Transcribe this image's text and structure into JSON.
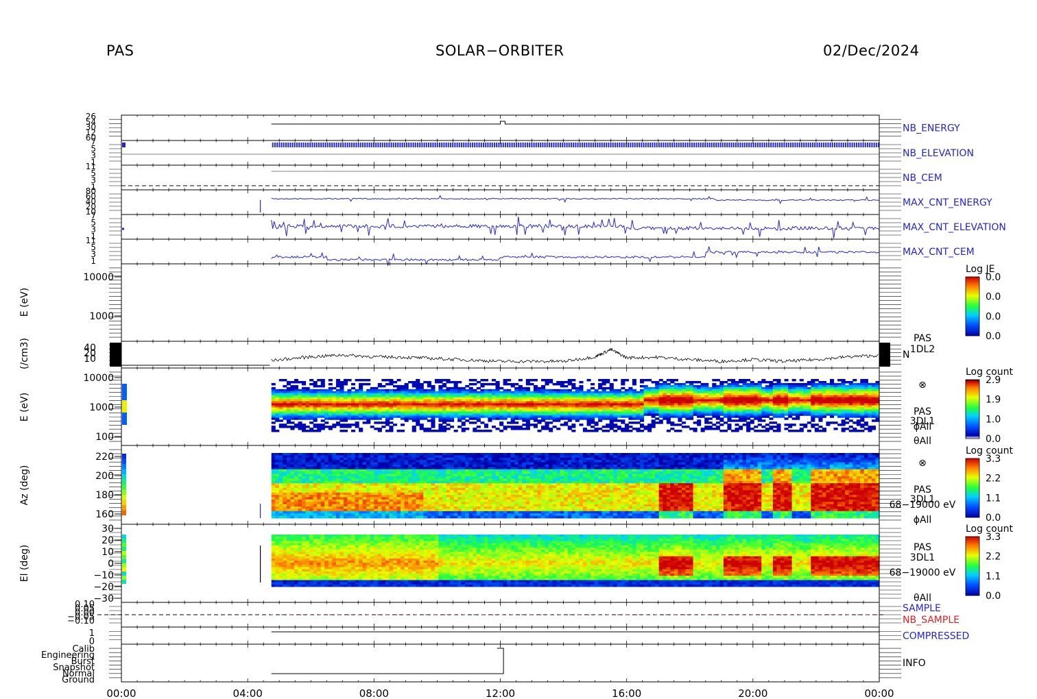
{
  "header": {
    "left": "PAS",
    "center": "SOLAR−ORBITER",
    "right": "02/Dec/2024"
  },
  "x_ticks": [
    "00:00",
    "04:00",
    "08:00",
    "12:00",
    "16:00",
    "20:00",
    "00:00"
  ],
  "panels": [
    {
      "id": "nb-energy",
      "label": "NB_ENERGY",
      "color": "#2424d6"
    },
    {
      "id": "nb-elevation",
      "label": "NB_ELEVATION",
      "color": "#2424d6"
    },
    {
      "id": "nb-cem",
      "label": "NB_CEM",
      "color": "#2424d6"
    },
    {
      "id": "max-cnt-energy",
      "label": "MAX_CNT_ENERGY",
      "color": "#2424d6"
    },
    {
      "id": "max-cnt-elevation",
      "label": "MAX_CNT_ELEVATION",
      "color": "#2424d6"
    },
    {
      "id": "max-cnt-cem",
      "label": "MAX_CNT_CEM",
      "color": "#2424d6"
    },
    {
      "id": "je-spectrogram",
      "ylabel": "E (eV)",
      "yticks": [
        "10000",
        "1000"
      ],
      "colorbar": {
        "title": "Log JE",
        "ticks": [
          "0.0",
          "0.0",
          "0.0",
          "0.0"
        ]
      }
    },
    {
      "id": "density",
      "ylabel": "(/cm3)",
      "yticks": [
        "40",
        "20",
        "10"
      ],
      "label": "N",
      "side_lines": [
        "PAS",
        "1DL2"
      ]
    },
    {
      "id": "energy-spectrogram",
      "ylabel": "E (eV)",
      "yticks": [
        "10000",
        "1000",
        "100"
      ],
      "side_lines": [
        "⊗",
        "PAS",
        "3DL1",
        "ϕAll",
        "θAll"
      ],
      "colorbar": {
        "title": "Log count",
        "ticks": [
          "2.9",
          "1.9",
          "1.0",
          "0.0"
        ]
      }
    },
    {
      "id": "azimuth-spectrogram",
      "ylabel": "Az (deg)",
      "yticks": [
        "220",
        "200",
        "180",
        "160"
      ],
      "side_lines": [
        "⊗",
        "PAS",
        "3DL1",
        "68−19000 eV",
        "ϕAll"
      ],
      "colorbar": {
        "title": "Log count",
        "ticks": [
          "3.3",
          "2.2",
          "1.1",
          "0.0"
        ]
      }
    },
    {
      "id": "elevation-spectrogram",
      "ylabel": "El (deg)",
      "yticks": [
        "30",
        "20",
        "10",
        "0",
        "−10",
        "−20",
        "−30"
      ],
      "side_lines": [
        "PAS",
        "3DL1",
        "68−19000 eV",
        "θAll"
      ],
      "colorbar": {
        "title": "Log count",
        "ticks": [
          "3.3",
          "2.2",
          "1.1",
          "0.0"
        ]
      }
    },
    {
      "id": "sample",
      "labels": [
        {
          "text": "SAMPLE",
          "color": "#2424d6"
        },
        {
          "text": "NB_SAMPLE",
          "color": "#e02020"
        }
      ],
      "yticks": [
        "0.10",
        "0.05",
        "0.00",
        "−0.05",
        "−0.10"
      ]
    },
    {
      "id": "compressed",
      "label": "COMPRESSED",
      "color": "#2424d6",
      "yticks": [
        "1",
        "0"
      ]
    },
    {
      "id": "info",
      "label": "INFO",
      "yticks": [
        "Calib",
        "Engineering",
        "Burst",
        "Snapshot",
        "Normal",
        "Ground"
      ]
    }
  ],
  "chart_data": [
    {
      "type": "line",
      "title": "NB_ENERGY",
      "xlim": [
        "00:00",
        "24:00"
      ],
      "note_values": [
        0,
        0,
        0,
        1,
        0
      ],
      "x": [
        "04:45",
        "12:00",
        "12:10",
        "24:00"
      ],
      "y": [
        0,
        1,
        0,
        0
      ]
    },
    {
      "type": "scatter",
      "title": "MAX_CNT_ENERGY"
    },
    {
      "type": "scatter",
      "title": "MAX_CNT_ELEVATION"
    },
    {
      "type": "scatter",
      "title": "MAX_CNT_CEM"
    },
    {
      "type": "heatmap",
      "title": "Log JE",
      "ylabel": "E (eV)",
      "yscale": "log",
      "ylim": [
        100,
        20000
      ]
    },
    {
      "type": "line",
      "title": "N",
      "ylabel": "(/cm3)",
      "yticks": [
        10,
        20,
        40
      ],
      "x": [
        "04:45",
        "06:00",
        "07:00",
        "08:00",
        "09:00",
        "10:00",
        "11:00",
        "12:00",
        "13:00",
        "14:00",
        "15:00",
        "15:30",
        "16:00",
        "17:00",
        "18:00",
        "19:00",
        "20:00",
        "21:00",
        "22:00",
        "23:00",
        "24:00"
      ],
      "y": [
        12,
        20,
        24,
        20,
        19,
        16,
        13,
        10,
        10,
        10,
        20,
        36,
        18,
        19,
        14,
        10,
        14,
        10,
        14,
        20,
        23
      ]
    },
    {
      "type": "heatmap",
      "title": "Log count",
      "ylabel": "E (eV)",
      "yscale": "log",
      "colorbar_range": [
        0.0,
        2.9
      ]
    },
    {
      "type": "heatmap",
      "title": "Log count",
      "ylabel": "Az (deg)",
      "ylim": [
        150,
        225
      ],
      "colorbar_range": [
        0.0,
        3.3
      ]
    },
    {
      "type": "heatmap",
      "title": "Log count",
      "ylabel": "El (deg)",
      "ylim": [
        -30,
        30
      ],
      "colorbar_range": [
        0.0,
        3.3
      ]
    }
  ]
}
